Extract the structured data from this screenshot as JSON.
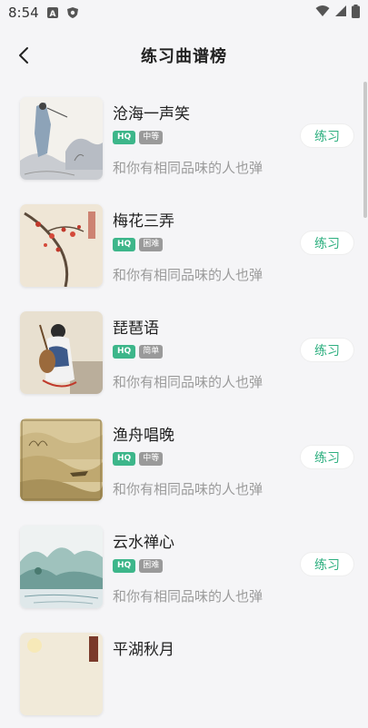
{
  "status_bar": {
    "time": "8:54"
  },
  "header": {
    "title": "练习曲谱榜"
  },
  "colors": {
    "accent": "#2daf7f",
    "hq_tag": "#3db68a",
    "level_tag": "#9a9a9a",
    "background": "#f5f5f7"
  },
  "list": {
    "items": [
      {
        "title": "沧海一声笑",
        "hq": "HQ",
        "level": "中等",
        "desc": "和你有相同品味的人也弹",
        "button": "练习"
      },
      {
        "title": "梅花三弄",
        "hq": "HQ",
        "level": "困难",
        "desc": "和你有相同品味的人也弹",
        "button": "练习"
      },
      {
        "title": "琵琶语",
        "hq": "HQ",
        "level": "简单",
        "desc": "和你有相同品味的人也弹",
        "button": "练习"
      },
      {
        "title": "渔舟唱晚",
        "hq": "HQ",
        "level": "中等",
        "desc": "和你有相同品味的人也弹",
        "button": "练习"
      },
      {
        "title": "云水禅心",
        "hq": "HQ",
        "level": "困难",
        "desc": "和你有相同品味的人也弹",
        "button": "练习"
      },
      {
        "title": "平湖秋月"
      }
    ]
  },
  "icons": {
    "back": "chevron-left-icon",
    "wifi": "wifi-icon",
    "signal": "signal-icon",
    "battery": "battery-icon"
  }
}
